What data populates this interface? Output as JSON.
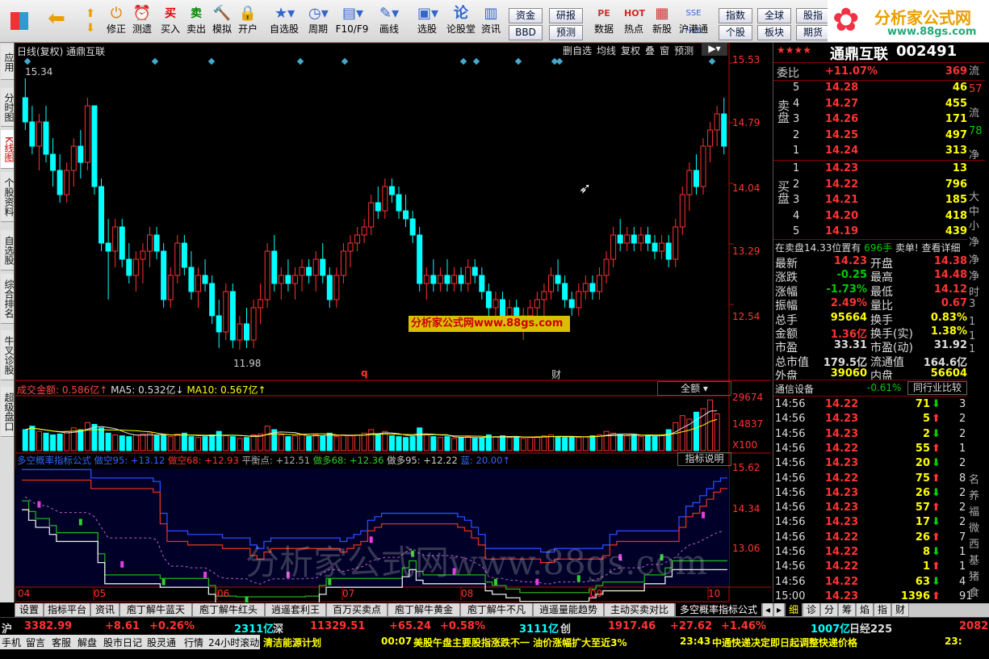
{
  "toolbar": {
    "buttons": [
      "",
      "",
      "修正",
      "测遗",
      "买入",
      "卖出",
      "模拟",
      "开户",
      "自选股",
      "周期",
      "F10/F9",
      "画线",
      "选股",
      "论股堂",
      "资讯",
      "数据",
      "热点",
      "新股",
      "沪港通"
    ],
    "small": [
      "资金",
      "BBD",
      "研报",
      "预测",
      "指数",
      "个股",
      "全球",
      "板块",
      "股指",
      "期货"
    ]
  },
  "logo": {
    "title": "分析家公式网",
    "url": "www.88gs.com"
  },
  "sidebar": {
    "tabs": [
      "应用",
      "分时图",
      "K线图",
      "个股资料",
      "自选股",
      "综合排名",
      "牛叉诊股",
      "超级盘口"
    ]
  },
  "chart": {
    "title": "日线(复权) 通鼎互联",
    "menu": [
      "删自选",
      "均线",
      "复权",
      "叠",
      "窗",
      "预测"
    ],
    "price_ticks": [
      "15.53",
      "14.79",
      "14.04",
      "13.29",
      "12.54"
    ],
    "high_label": "15.34",
    "low_label": "11.98",
    "markers": [
      "q",
      "财"
    ],
    "watermark_small": "分析家公式网www.88gs.com",
    "volume_header": {
      "label": "成交金额: 0.586亿↑",
      "ma5": "MA5: 0.532亿↓",
      "ma10": "MA10: 0.567亿↑"
    },
    "volume_selector": "全额",
    "volume_ticks": [
      "29674",
      "14837",
      "X100"
    ],
    "indicator_header": {
      "name": "多空概率指标公式",
      "a": "做空95: +13.12",
      "b": "做空68: +12.93",
      "c": "平衡点: +12.51",
      "d": "做多68: +12.36",
      "e": "做多95: +12.22",
      "f": "蓝: 20.00↑"
    },
    "indicator_button": "指标说明",
    "indicator_ticks": [
      "15.62",
      "14.34",
      "13.06"
    ],
    "x_labels": [
      "04",
      "05",
      "06",
      "07",
      "08",
      "09",
      "10"
    ],
    "watermark_big": "分析家公式网www.88gs.com"
  },
  "chart_data": {
    "type": "candlestick",
    "price_range": [
      11.6,
      15.6
    ],
    "ohlc": [
      [
        15.1,
        15.34,
        14.7,
        14.8
      ],
      [
        14.8,
        15.0,
        14.4,
        14.5
      ],
      [
        14.5,
        14.9,
        14.2,
        14.8
      ],
      [
        14.8,
        15.0,
        14.3,
        14.4
      ],
      [
        14.4,
        14.6,
        14.0,
        14.2
      ],
      [
        14.2,
        14.4,
        13.8,
        13.9
      ],
      [
        13.9,
        14.3,
        13.8,
        14.2
      ],
      [
        14.2,
        14.6,
        14.0,
        14.5
      ],
      [
        14.5,
        14.7,
        14.1,
        14.3
      ],
      [
        14.3,
        15.1,
        14.2,
        15.0
      ],
      [
        15.0,
        15.0,
        13.9,
        14.0
      ],
      [
        14.0,
        14.1,
        13.2,
        13.3
      ],
      [
        13.3,
        13.6,
        12.6,
        13.2
      ],
      [
        13.2,
        13.6,
        13.0,
        13.5
      ],
      [
        13.5,
        13.6,
        13.0,
        13.1
      ],
      [
        13.1,
        13.3,
        12.8,
        12.9
      ],
      [
        12.9,
        13.2,
        12.7,
        13.1
      ],
      [
        13.1,
        13.3,
        12.8,
        13.2
      ],
      [
        13.2,
        13.5,
        13.0,
        13.4
      ],
      [
        13.4,
        13.5,
        13.1,
        13.2
      ],
      [
        13.2,
        13.3,
        12.5,
        12.6
      ],
      [
        12.6,
        13.0,
        12.5,
        12.9
      ],
      [
        12.9,
        13.4,
        12.8,
        13.3
      ],
      [
        13.3,
        13.4,
        12.9,
        13.0
      ],
      [
        13.0,
        13.2,
        12.6,
        12.7
      ],
      [
        12.7,
        13.0,
        12.5,
        12.9
      ],
      [
        12.9,
        13.1,
        12.7,
        12.8
      ],
      [
        12.8,
        12.9,
        12.3,
        12.4
      ],
      [
        12.4,
        12.6,
        12.0,
        12.2
      ],
      [
        12.2,
        12.8,
        12.1,
        12.7
      ],
      [
        12.7,
        12.8,
        12.0,
        12.1
      ],
      [
        12.1,
        12.4,
        11.98,
        12.3
      ],
      [
        12.3,
        12.5,
        12.0,
        12.1
      ],
      [
        12.1,
        12.6,
        12.0,
        12.5
      ],
      [
        12.5,
        12.8,
        12.3,
        12.6
      ],
      [
        12.6,
        13.3,
        12.5,
        13.2
      ],
      [
        13.2,
        13.4,
        12.7,
        12.8
      ],
      [
        12.8,
        13.0,
        12.6,
        12.9
      ],
      [
        12.9,
        13.1,
        12.7,
        12.8
      ],
      [
        12.8,
        13.0,
        12.6,
        12.9
      ],
      [
        12.9,
        13.1,
        12.7,
        13.0
      ],
      [
        13.0,
        13.1,
        12.8,
        12.9
      ],
      [
        12.9,
        13.2,
        12.7,
        13.1
      ],
      [
        13.1,
        13.3,
        12.8,
        12.9
      ],
      [
        12.9,
        13.0,
        12.5,
        12.6
      ],
      [
        12.6,
        13.0,
        12.5,
        12.9
      ],
      [
        12.9,
        13.3,
        12.8,
        13.2
      ],
      [
        13.2,
        13.4,
        13.0,
        13.3
      ],
      [
        13.3,
        13.5,
        13.2,
        13.4
      ],
      [
        13.4,
        13.6,
        13.3,
        13.5
      ],
      [
        13.5,
        13.9,
        13.4,
        13.8
      ],
      [
        13.8,
        14.0,
        13.6,
        13.7
      ],
      [
        13.7,
        14.1,
        13.6,
        14.0
      ],
      [
        14.0,
        14.1,
        13.8,
        13.9
      ],
      [
        13.9,
        14.0,
        13.6,
        13.7
      ],
      [
        13.7,
        13.9,
        13.5,
        13.6
      ],
      [
        13.6,
        13.7,
        13.3,
        13.4
      ],
      [
        13.4,
        13.5,
        12.7,
        12.8
      ],
      [
        12.8,
        13.0,
        12.6,
        12.9
      ],
      [
        12.9,
        13.1,
        12.7,
        12.8
      ],
      [
        12.8,
        13.0,
        12.7,
        12.9
      ],
      [
        12.9,
        13.1,
        12.7,
        12.8
      ],
      [
        12.8,
        13.0,
        12.7,
        12.9
      ],
      [
        12.9,
        13.0,
        12.7,
        12.8
      ],
      [
        12.8,
        13.1,
        12.7,
        13.0
      ],
      [
        13.0,
        13.1,
        12.8,
        12.9
      ],
      [
        12.9,
        13.0,
        12.6,
        12.7
      ],
      [
        12.7,
        12.8,
        12.4,
        12.5
      ],
      [
        12.5,
        12.7,
        12.3,
        12.6
      ],
      [
        12.6,
        12.7,
        12.3,
        12.4
      ],
      [
        12.4,
        12.6,
        12.2,
        12.5
      ],
      [
        12.5,
        12.6,
        12.2,
        12.3
      ],
      [
        12.3,
        12.5,
        12.1,
        12.4
      ],
      [
        12.4,
        12.6,
        12.2,
        12.5
      ],
      [
        12.5,
        12.7,
        12.3,
        12.6
      ],
      [
        12.6,
        12.8,
        12.4,
        12.7
      ],
      [
        12.7,
        13.0,
        12.6,
        12.9
      ],
      [
        12.9,
        13.1,
        12.7,
        12.8
      ],
      [
        12.8,
        12.9,
        12.5,
        12.6
      ],
      [
        12.6,
        12.7,
        12.4,
        12.5
      ],
      [
        12.5,
        12.8,
        12.4,
        12.7
      ],
      [
        12.7,
        12.9,
        12.6,
        12.8
      ],
      [
        12.8,
        12.9,
        12.6,
        12.7
      ],
      [
        12.7,
        13.0,
        12.6,
        12.9
      ],
      [
        12.9,
        13.2,
        12.8,
        13.1
      ],
      [
        13.1,
        13.5,
        13.0,
        13.4
      ],
      [
        13.4,
        13.6,
        13.2,
        13.3
      ],
      [
        13.3,
        13.5,
        13.2,
        13.4
      ],
      [
        13.4,
        13.5,
        13.2,
        13.3
      ],
      [
        13.3,
        13.5,
        13.2,
        13.4
      ],
      [
        13.4,
        13.5,
        13.2,
        13.3
      ],
      [
        13.3,
        13.4,
        13.1,
        13.2
      ],
      [
        13.2,
        13.4,
        13.1,
        13.3
      ],
      [
        13.3,
        13.4,
        13.0,
        13.1
      ],
      [
        13.1,
        13.6,
        13.0,
        13.5
      ],
      [
        13.5,
        14.0,
        13.4,
        13.9
      ],
      [
        13.9,
        14.3,
        13.7,
        14.2
      ],
      [
        14.2,
        14.4,
        13.9,
        14.0
      ],
      [
        14.0,
        14.6,
        13.9,
        14.5
      ],
      [
        14.5,
        14.8,
        14.3,
        14.7
      ],
      [
        14.7,
        15.0,
        14.5,
        14.9
      ],
      [
        14.9,
        15.1,
        14.4,
        14.5
      ]
    ],
    "volume_range": [
      0,
      30000
    ],
    "volume": [
      12000,
      14000,
      11000,
      10000,
      9000,
      9500,
      11000,
      13000,
      12000,
      16000,
      15000,
      13000,
      10000,
      9000,
      8500,
      8000,
      9000,
      9500,
      10000,
      8500,
      9000,
      8000,
      9500,
      10000,
      8000,
      7500,
      8000,
      9000,
      11000,
      8500,
      8000,
      7000,
      7500,
      9000,
      9500,
      14000,
      12000,
      9000,
      8000,
      8500,
      9000,
      8000,
      9000,
      8500,
      10000,
      8000,
      9000,
      8500,
      9000,
      10000,
      12000,
      9000,
      11000,
      8500,
      8000,
      7500,
      8000,
      13000,
      9000,
      8000,
      7500,
      8000,
      7000,
      7500,
      8000,
      7000,
      7500,
      9000,
      8000,
      8500,
      7500,
      8000,
      7000,
      7500,
      8000,
      8500,
      9000,
      8000,
      7500,
      8000,
      7500,
      8000,
      8500,
      9000,
      11000,
      10000,
      9000,
      8500,
      9000,
      8000,
      8500,
      8000,
      9000,
      12000,
      16000,
      20000,
      18000,
      22000,
      24000,
      29000,
      21000
    ],
    "indicator_range": [
      12.5,
      15.8
    ],
    "timeline_months": [
      "04",
      "05",
      "06",
      "07",
      "08",
      "09",
      "10"
    ]
  },
  "stock": {
    "stars": "★★★★",
    "name": "通鼎互联",
    "code": "002491",
    "weibi_label": "委比",
    "weibi": "+11.07%",
    "weicha": "369",
    "sell": [
      [
        "5",
        "14.28",
        "46"
      ],
      [
        "4",
        "14.27",
        "455"
      ],
      [
        "3",
        "14.26",
        "171"
      ],
      [
        "2",
        "14.25",
        "497"
      ],
      [
        "1",
        "14.24",
        "313"
      ]
    ],
    "buy": [
      [
        "1",
        "14.23",
        "13"
      ],
      [
        "2",
        "14.22",
        "796"
      ],
      [
        "3",
        "14.21",
        "185"
      ],
      [
        "4",
        "14.20",
        "418"
      ],
      [
        "5",
        "14.19",
        "439"
      ]
    ],
    "sell_label": "卖盘",
    "buy_label": "买盘",
    "notice": "在卖盘14.33位置有",
    "notice_qty": "696手",
    "notice_act": "卖单! 查看详细",
    "stats": [
      [
        "最新",
        "14.23",
        "开盘",
        "14.38"
      ],
      [
        "涨跌",
        "-0.25",
        "最高",
        "14.48"
      ],
      [
        "涨幅",
        "-1.73%",
        "最低",
        "14.12"
      ],
      [
        "振幅",
        "2.49%",
        "量比",
        "0.67"
      ],
      [
        "总手",
        "95664",
        "换手",
        "0.83%"
      ],
      [
        "金额",
        "1.36亿",
        "换手(实)",
        "1.38%"
      ],
      [
        "市盈",
        "33.31",
        "市盈(动)",
        "31.92"
      ],
      [
        "总市值",
        "179.5亿",
        "流通值",
        "164.6亿"
      ],
      [
        "外盘",
        "39060",
        "内盘",
        "56604"
      ]
    ],
    "industry": "通信设备",
    "industry_chg": "-0.61%",
    "industry_btn": "同行业比较",
    "ticks": [
      [
        "14:56",
        "14.22",
        "71"
      ],
      [
        "14:56",
        "14.23",
        "5"
      ],
      [
        "14:56",
        "14.23",
        "2"
      ],
      [
        "14:56",
        "14.22",
        "55"
      ],
      [
        "14:56",
        "14.23",
        "20"
      ],
      [
        "14:56",
        "14.22",
        "75"
      ],
      [
        "14:56",
        "14.23",
        "26"
      ],
      [
        "14:56",
        "14.23",
        "57"
      ],
      [
        "14:56",
        "14.23",
        "17"
      ],
      [
        "14:56",
        "14.22",
        "26"
      ],
      [
        "14:56",
        "14.22",
        "8"
      ],
      [
        "14:56",
        "14.22",
        "1"
      ],
      [
        "14:56",
        "14.22",
        "63"
      ],
      [
        "15:00",
        "14.23",
        "1396"
      ]
    ],
    "side_chars": [
      "流",
      "57",
      "流",
      "78",
      "净",
      "大",
      "中",
      "小",
      "净",
      "净",
      "净",
      "时",
      "3",
      "1",
      "1",
      "1",
      "名",
      "养",
      "福",
      "微",
      "西",
      "基",
      "猪",
      "食"
    ],
    "tick_tail": [
      "3",
      "2",
      "2",
      "1",
      "2",
      "8",
      "2",
      "2",
      "2",
      "7",
      "1",
      "1",
      "4",
      "91"
    ]
  },
  "tabs": {
    "items": [
      "设置",
      "指标平台",
      "资讯",
      "庖丁解牛蓝天",
      "庖丁解牛红头",
      "逍遥套利王",
      "百万买卖点",
      "庖丁解牛黄金",
      "庖丁解牛不凡",
      "逍遥量能趋势",
      "主动买卖对比",
      "多空概率指标公式"
    ],
    "right": [
      "细",
      "诊",
      "分",
      "筹",
      "焰",
      "指",
      "财"
    ]
  },
  "status": {
    "sh_label": "沪",
    "sh_val": "3382.99",
    "sh_chg": "+8.61",
    "sh_pct": "+0.26%",
    "sh_amt": "2311亿",
    "sz_label": "深",
    "sz_val": "11329.51",
    "sz_chg": "+65.24",
    "sz_pct": "+0.58%",
    "sz_amt": "3111亿",
    "cy_label": "创",
    "cy_val": "1917.46",
    "cy_chg": "+27.62",
    "cy_pct": "+1.46%",
    "cy_amt": "1007亿",
    "rj_label": "日经225",
    "rj_val": "2082"
  },
  "bottom": {
    "items": [
      "手机",
      "留言",
      "客服",
      "解盘",
      "股市日记",
      "股灵通",
      "行情",
      "24小时滚动"
    ],
    "news1": "清洁能源计划",
    "news2_time": "00:07",
    "news2": "美股午盘主要股指涨跌不一 油价涨幅扩大至近3%",
    "news3_time": "23:43",
    "news3": "中通快递决定即日起调整快递价格",
    "tail": "23:"
  },
  "colors": {
    "up": "#ff3232",
    "down": "#00ffff",
    "yellow": "#ffff00",
    "axis": "#c80000"
  }
}
